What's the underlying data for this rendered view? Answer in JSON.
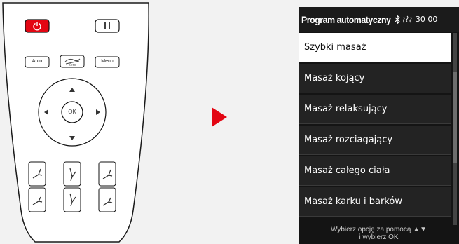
{
  "remote": {
    "auto_label": "Auto",
    "zero_label": "Zero",
    "menu_label": "Menu",
    "ok_label": "OK",
    "power_icon": "power-icon",
    "pause_icon": "pause-icon"
  },
  "screen": {
    "header_title": "Program automatyczny",
    "bluetooth_icon": "bluetooth-icon",
    "heat_icon": "heat-icon",
    "timer": "30 00",
    "menu_items": [
      "Szybki masaż",
      "Masaż kojący",
      "Masaż relaksujący",
      "Masaż rozciagający",
      "Masaż całego ciała",
      "Masaż karku i barków"
    ],
    "footer_line1": "Wybierz opcję za pomocą ▲▼",
    "footer_line2": "i wybierz OK"
  },
  "colors": {
    "accent_red": "#e30613",
    "screen_bg": "#141414",
    "page_bg": "#f2f2f2"
  }
}
